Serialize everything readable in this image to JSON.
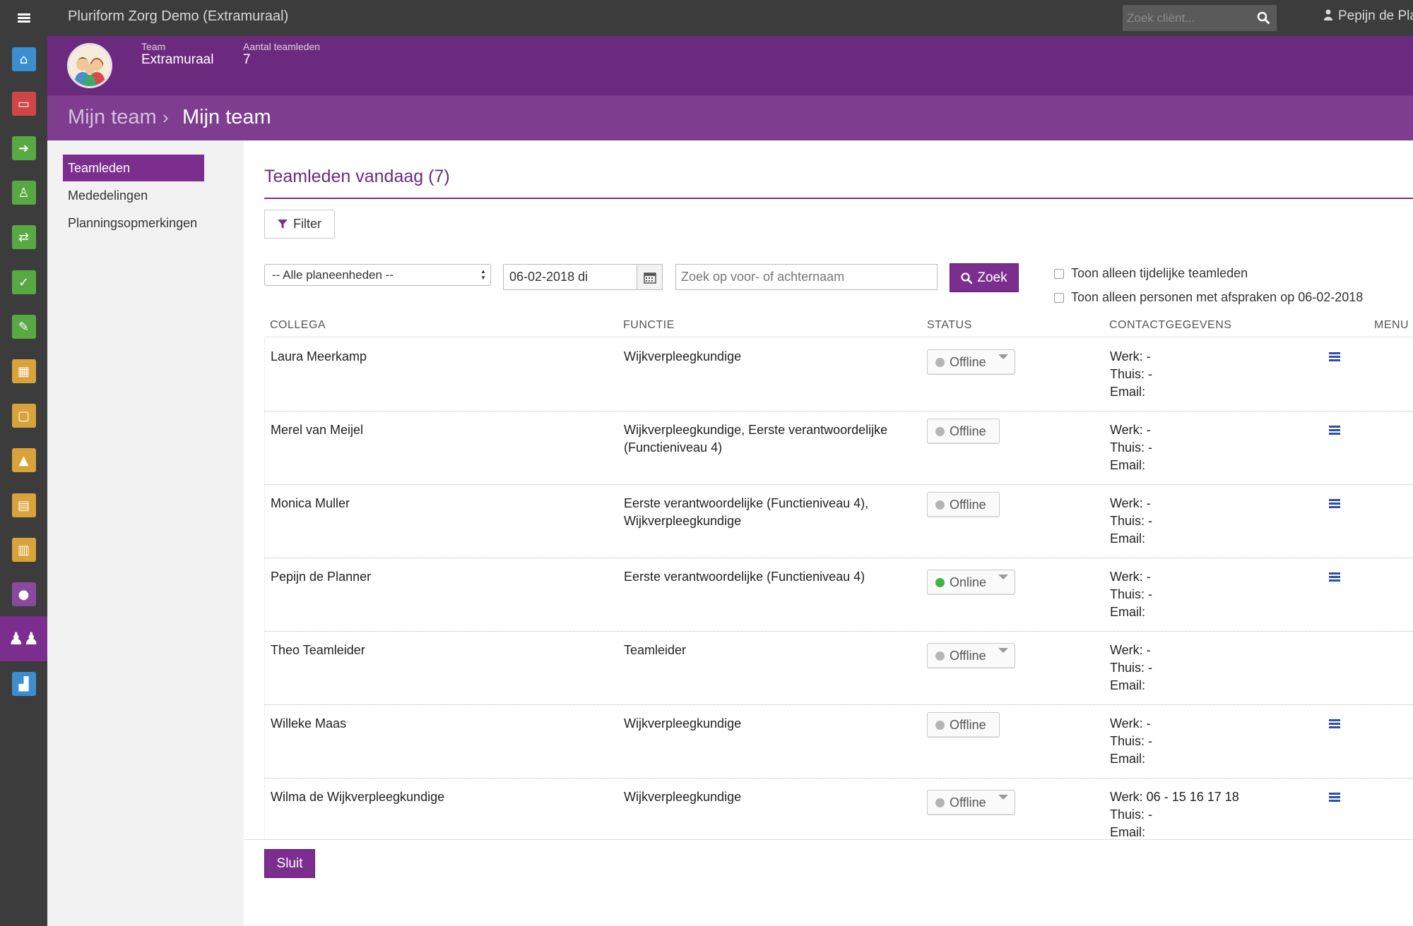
{
  "app": {
    "title": "Pluriform Zorg Demo  (Extramuraal)"
  },
  "topbar": {
    "search_placeholder": "Zoek cliënt...",
    "user_name": "Pepijn de Pla"
  },
  "rail": {
    "items": [
      {
        "name": "home-icon",
        "glyph": "⌂",
        "color": "#3b8fd0"
      },
      {
        "name": "inbox-icon",
        "glyph": "▭",
        "color": "#cf4646"
      },
      {
        "name": "sign-in-icon",
        "glyph": "➜",
        "color": "#58a943"
      },
      {
        "name": "person-icon",
        "glyph": "♙",
        "color": "#58a943"
      },
      {
        "name": "shuffle-icon",
        "glyph": "⇄",
        "color": "#58a943"
      },
      {
        "name": "calendar-check-icon",
        "glyph": "✓",
        "color": "#58a943"
      },
      {
        "name": "pencil-icon",
        "glyph": "✎",
        "color": "#58a943"
      },
      {
        "name": "calendar-icon",
        "glyph": "▦",
        "color": "#d8a33a"
      },
      {
        "name": "calendar-empty-icon",
        "glyph": "▢",
        "color": "#d8a33a"
      },
      {
        "name": "road-icon",
        "glyph": "▲",
        "color": "#d8a33a"
      },
      {
        "name": "clipboard-icon",
        "glyph": "▤",
        "color": "#d8a33a"
      },
      {
        "name": "sliders-icon",
        "glyph": "▥",
        "color": "#d8a33a"
      },
      {
        "name": "user-icon",
        "glyph": "●",
        "color": "#8a4a9c"
      },
      {
        "name": "team-icon",
        "glyph": "♟♟",
        "color": "#7b2e8e"
      },
      {
        "name": "chart-icon",
        "glyph": "▟",
        "color": "#3b8fd0"
      }
    ]
  },
  "team_header": {
    "team_label": "Team",
    "team_value": "Extramuraal",
    "count_label": "Aantal teamleden",
    "count_value": "7"
  },
  "breadcrumb": {
    "parent": "Mijn team",
    "separator": "›",
    "current": "Mijn team"
  },
  "subnav": {
    "items": [
      "Teamleden",
      "Mededelingen",
      "Planningsopmerkingen"
    ]
  },
  "main": {
    "title": "Teamleden vandaag (7)",
    "filter_label": "Filter",
    "planning_select": "-- Alle planeenheden --",
    "date_value": "06-02-2018 di",
    "name_placeholder": "Zoek op voor- of achternaam",
    "search_label": "Zoek",
    "check_temp": "Toon alleen tijdelijke teamleden",
    "check_appointments": "Toon alleen personen met afspraken op 06-02-2018",
    "close_label": "Sluit"
  },
  "table": {
    "columns": [
      "COLLEGA",
      "FUNCTIE",
      "STATUS",
      "CONTACTGEGEVENS",
      "MENU"
    ],
    "rows": [
      {
        "name": "Laura Meerkamp",
        "function": [
          "Wijkverpleegkundige"
        ],
        "status": "Offline",
        "dropdown": true,
        "werk": "Werk: -",
        "thuis": "Thuis: -",
        "email": "Email:",
        "menu": true
      },
      {
        "name": "Merel van Meijel",
        "function": [
          "Wijkverpleegkundige, Eerste verantwoordelijke",
          "(Functieniveau 4)"
        ],
        "status": "Offline",
        "dropdown": false,
        "werk": "Werk: -",
        "thuis": "Thuis: -",
        "email": "Email:",
        "menu": true
      },
      {
        "name": "Monica Muller",
        "function": [
          "Eerste verantwoordelijke (Functieniveau 4),",
          "Wijkverpleegkundige"
        ],
        "status": "Offline",
        "dropdown": false,
        "werk": "Werk: -",
        "thuis": "Thuis: -",
        "email": "Email:",
        "menu": true
      },
      {
        "name": "Pepijn de Planner",
        "function": [
          "Eerste verantwoordelijke (Functieniveau 4)"
        ],
        "status": "Online",
        "dropdown": true,
        "werk": "Werk: -",
        "thuis": "Thuis: -",
        "email": "Email:",
        "menu": true
      },
      {
        "name": "Theo Teamleider",
        "function": [
          "Teamleider"
        ],
        "status": "Offline",
        "dropdown": true,
        "werk": "Werk: -",
        "thuis": "Thuis: -",
        "email": "Email:",
        "menu": false
      },
      {
        "name": "Willeke Maas",
        "function": [
          "Wijkverpleegkundige"
        ],
        "status": "Offline",
        "dropdown": false,
        "werk": "Werk: -",
        "thuis": "Thuis: -",
        "email": "Email:",
        "menu": true
      },
      {
        "name": "Wilma de Wijkverpleegkundige",
        "function": [
          "Wijkverpleegkundige"
        ],
        "status": "Offline",
        "dropdown": true,
        "werk": "Werk: 06 - 15 16 17 18",
        "thuis": "Thuis: -",
        "email": "Email:",
        "menu": true
      }
    ]
  },
  "colors": {
    "purple_dark": "#6c2a7e",
    "purple": "#7b2e8e",
    "online": "#3fb53f",
    "offline": "#b5b5b5",
    "menu_blue": "#2f4ea6"
  }
}
